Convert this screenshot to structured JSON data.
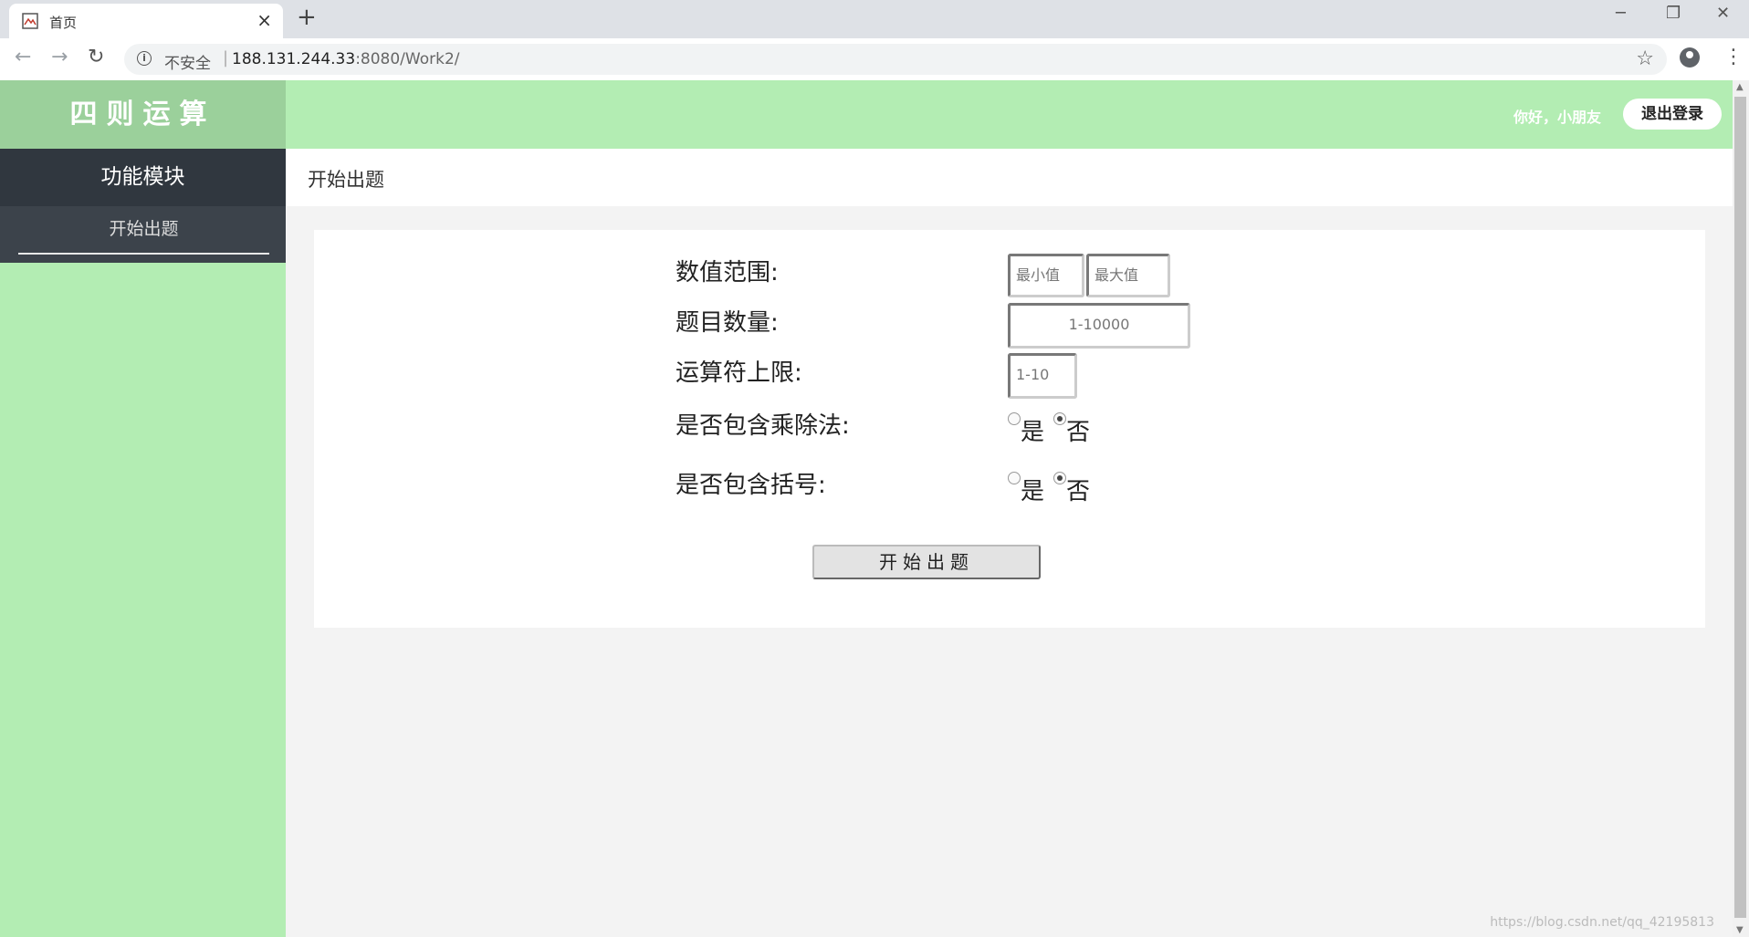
{
  "browser": {
    "tab_title": "首页",
    "close_glyph": "×",
    "new_tab_glyph": "+",
    "insecure_label": "不安全",
    "url_host": "188.131.244.33",
    "url_rest": ":8080/Work2/",
    "icons": [
      "back-arrow-icon",
      "forward-arrow-icon",
      "reload-icon",
      "info-icon",
      "star-icon",
      "account-icon",
      "menu-icon"
    ]
  },
  "header": {
    "logo": "四则运算",
    "greeting": "你好，小朋友",
    "logout_label": "退出登录",
    "accent_color": "#b3edb3",
    "logo_bg_color": "#9bd09b"
  },
  "sidebar": {
    "title": "功能模块",
    "items": [
      {
        "label": "开始出题"
      }
    ],
    "title_bg_color": "#30373f"
  },
  "breadcrumb": "开始出题",
  "form": {
    "range": {
      "label": "数值范围:",
      "min_placeholder": "最小值",
      "max_placeholder": "最大值"
    },
    "count": {
      "label": "题目数量:",
      "placeholder": "1-10000"
    },
    "operators": {
      "label": "运算符上限:",
      "placeholder": "1-10"
    },
    "muldiv": {
      "label": "是否包含乘除法:",
      "yes": "是",
      "no": "否",
      "selected": "否"
    },
    "brackets": {
      "label": "是否包含括号:",
      "yes": "是",
      "no": "否",
      "selected": "否"
    },
    "submit_label": "开始出题"
  },
  "watermark": "https://blog.csdn.net/qq_42195813"
}
